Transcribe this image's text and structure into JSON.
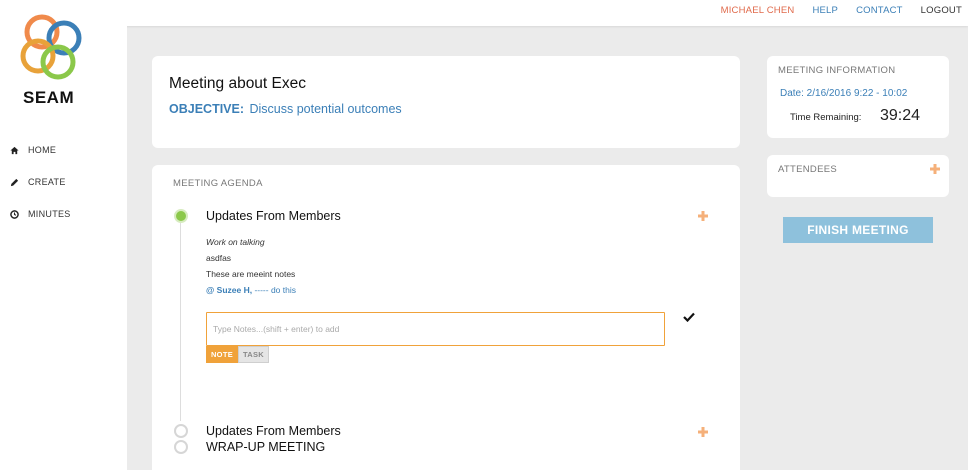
{
  "app": {
    "logo_text": "SEAM"
  },
  "topnav": {
    "user": "MICHAEL CHEN",
    "help": "HELP",
    "contact": "CONTACT",
    "logout": "LOGOUT"
  },
  "sidebar": {
    "items": [
      {
        "label": "HOME",
        "icon": "home-icon"
      },
      {
        "label": "CREATE",
        "icon": "pencil-icon"
      },
      {
        "label": "MINUTES",
        "icon": "clock-icon"
      }
    ]
  },
  "meeting": {
    "title": "Meeting about Exec",
    "objective_label": "OBJECTIVE:",
    "objective_text": "Discuss potential outcomes"
  },
  "agenda": {
    "label": "MEETING AGENDA",
    "items": [
      {
        "title": "Updates From Members",
        "status": "active",
        "notes": [
          "Work on talking",
          "asdfas",
          "These are meeint notes"
        ],
        "mention_name": "@ Suzee H,",
        "mention_text": " ----- do this"
      },
      {
        "title": "Updates From Members",
        "status": "pending"
      },
      {
        "title": "WRAP-UP MEETING",
        "status": "pending"
      }
    ],
    "notes_placeholder": "Type Notes...(shift + enter) to add",
    "tab_note": "NOTE",
    "tab_task": "TASK"
  },
  "info": {
    "label": "MEETING INFORMATION",
    "date": "Date: 2/16/2016 9:22 - 10:02",
    "remaining_label": "Time Remaining:",
    "remaining_value": "39:24"
  },
  "attendees": {
    "label": "ATTENDEES"
  },
  "finish_button": "FINISH MEETING",
  "colors": {
    "accent_blue": "#3b7fb7",
    "accent_orange": "#f0a23a",
    "active_green": "#8bc84a",
    "user_red": "#e06a4b",
    "finish_blue": "#8ec1dc"
  }
}
